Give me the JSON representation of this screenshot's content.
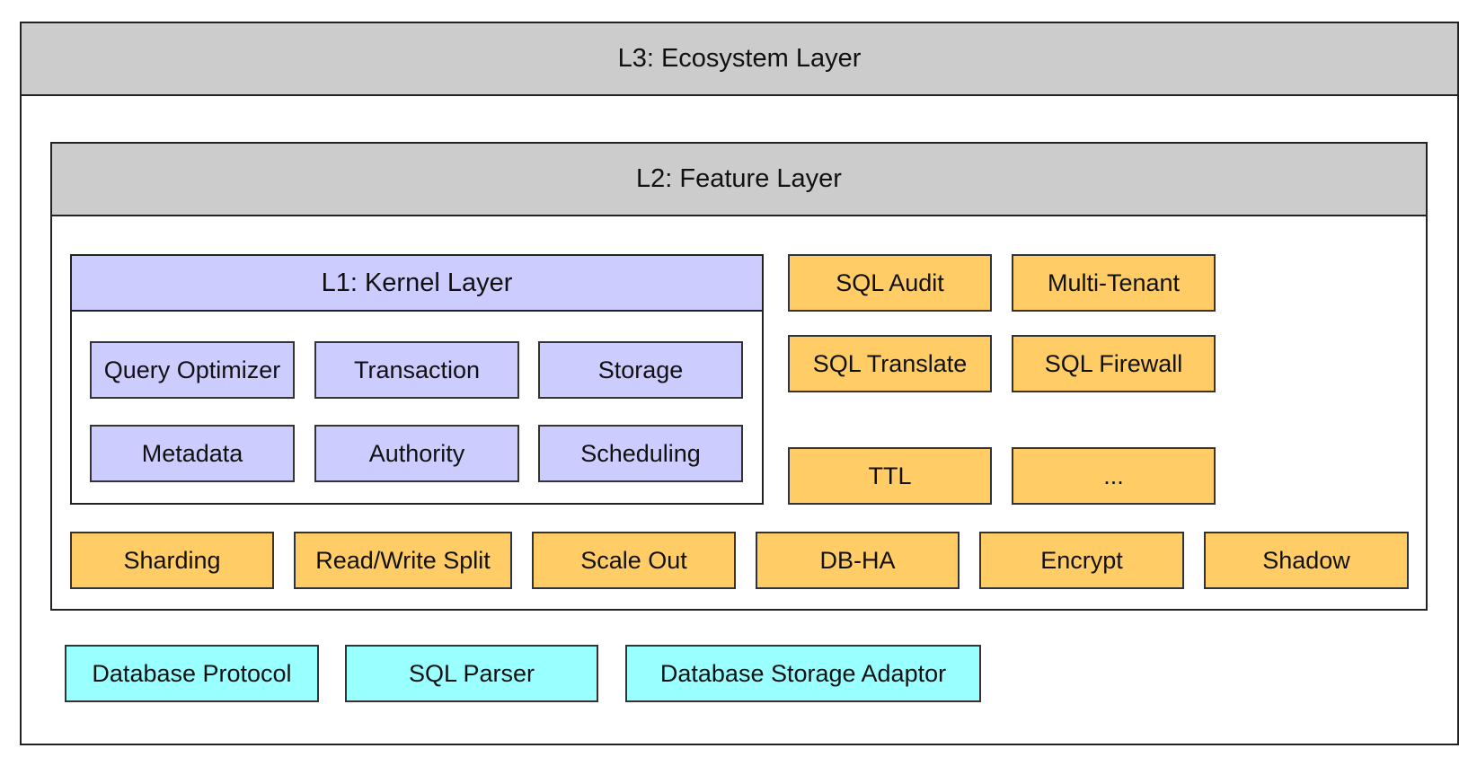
{
  "layers": {
    "l3": {
      "title": "L3: Ecosystem Layer"
    },
    "l2": {
      "title": "L2: Feature Layer"
    },
    "l1": {
      "title": "L1: Kernel Layer"
    }
  },
  "kernel_modules": [
    "Query Optimizer",
    "Transaction",
    "Storage",
    "Metadata",
    "Authority",
    "Scheduling"
  ],
  "feature_plugins": [
    "SQL Audit",
    "Multi-Tenant",
    "SQL Translate",
    "SQL Firewall",
    "TTL",
    "..."
  ],
  "feature_core": [
    "Sharding",
    "Read/Write Split",
    "Scale Out",
    "DB-HA",
    "Encrypt",
    "Shadow"
  ],
  "ecosystem_components": [
    "Database Protocol",
    "SQL Parser",
    "Database Storage Adaptor"
  ],
  "colors": {
    "layer_header": "#cccccc",
    "kernel": "#ccccff",
    "feature": "#ffcc66",
    "ecosystem": "#99ffff"
  }
}
